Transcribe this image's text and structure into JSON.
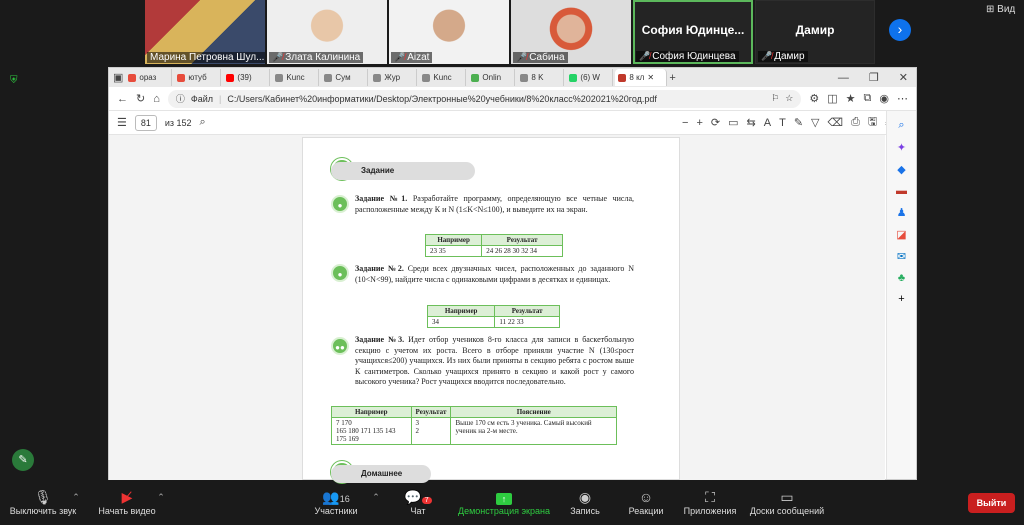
{
  "participants": [
    {
      "name": "Марина Петровна Шул..."
    },
    {
      "name": "Злата Калинина"
    },
    {
      "name": "Aizat"
    },
    {
      "name": "Сабина"
    },
    {
      "name": "София Юдинцева",
      "big": "София  Юдинце..."
    },
    {
      "name": "Дамир",
      "big": "Дамир"
    }
  ],
  "view_label": "Вид",
  "tabs": [
    "ораз",
    "ютуб",
    "(39)",
    "Kunc",
    "Сум",
    "Жур",
    "Kunc",
    "Onlin",
    "8 K",
    "(6) W",
    "8 кл"
  ],
  "address": {
    "scheme": "Файл",
    "url": "C:/Users/Кабинет%20информатики/Desktop/Электронные%20учебники/8%20класс%202021%20год.pdf"
  },
  "pdf": {
    "page": "81",
    "total": "из 152"
  },
  "content": {
    "section_title": "Задание",
    "task1": {
      "title": "Задание №1.",
      "text": "Разработайте программу, определяющую все четные числа, расположенные между К и N (1≤K<N≤100), и выведите их на экран.",
      "h1": "Например",
      "h2": "Результат",
      "c1": "23 35",
      "c2": "24 26 28 30 32 34"
    },
    "task2": {
      "title": "Задание №2.",
      "text": "Среди всех двузначных чисел, расположенных до заданного N (10<N<99), найдите числа с одинаковыми цифрами в десятках и единицах.",
      "h1": "Например",
      "h2": "Результат",
      "c1": "34",
      "c2": "11 22 33"
    },
    "task3": {
      "title": "Задание №3.",
      "text": "Идет отбор учеников 8-го класса для записи в баскетбольную секцию с учетом их роста. Всего в отборе приняли участие N (130≤рост учащихся≤200) учащихся. Из них были приняты в секцию ребята с ростом выше К сантиметров. Сколько учащихся принято в секцию и какой рост у самого высокого ученика? Рост учащихся вводится последовательно.",
      "h1": "Например",
      "h2": "Результат",
      "h3": "Пояснение",
      "c1a": "7 170",
      "c1b": "165 180 171 135 143 175 169",
      "c2a": "3",
      "c2b": "2",
      "c3": "Выше 170 см есть 3 ученика. Самый высокий ученик на 2-м месте."
    },
    "homework": "Домашнее задание"
  },
  "toolbar": {
    "mute": "Выключить звук",
    "video": "Начать видео",
    "participants": "Участники",
    "participants_count": "16",
    "chat": "Чат",
    "chat_badge": "7",
    "share": "Демонстрация экрана",
    "record": "Запись",
    "reactions": "Реакции",
    "apps": "Приложения",
    "whiteboards": "Доски сообщений",
    "leave": "Выйти"
  },
  "colors": {
    "accent_green": "#6cbf5a",
    "leave_red": "#c91f1f",
    "share_green": "#2ecc40"
  }
}
